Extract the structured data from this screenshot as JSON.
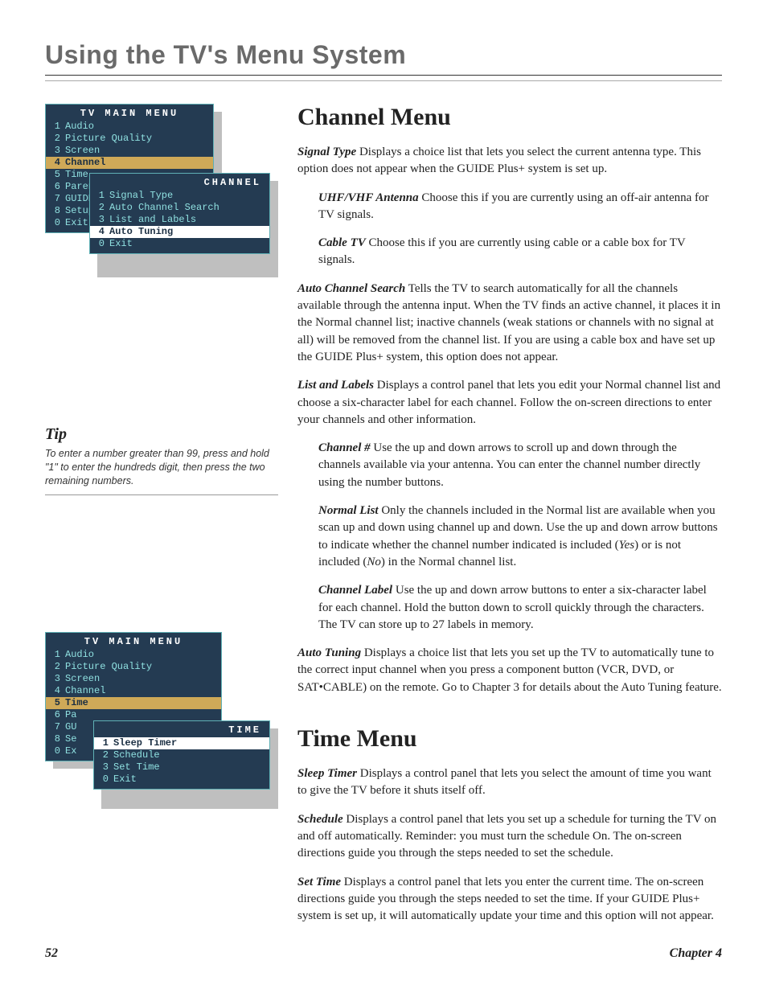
{
  "chapter_title": "Using the TV's Menu System",
  "menu1": {
    "title": "TV MAIN MENU",
    "items": [
      {
        "n": "1",
        "label": "Audio"
      },
      {
        "n": "2",
        "label": "Picture Quality"
      },
      {
        "n": "3",
        "label": "Screen"
      },
      {
        "n": "4",
        "label": "Channel"
      },
      {
        "n": "5",
        "label": "Time"
      },
      {
        "n": "6",
        "label": "Parental"
      },
      {
        "n": "7",
        "label": "GUIDE"
      },
      {
        "n": "8",
        "label": "Setup"
      },
      {
        "n": "0",
        "label": "Exit"
      }
    ],
    "highlight_index": 3,
    "sub_title": "CHANNEL",
    "sub_items": [
      {
        "n": "1",
        "label": "Signal Type"
      },
      {
        "n": "2",
        "label": "Auto Channel Search"
      },
      {
        "n": "3",
        "label": "List and Labels"
      },
      {
        "n": "4",
        "label": "Auto Tuning"
      },
      {
        "n": "0",
        "label": "Exit"
      }
    ],
    "sub_highlight_index": 3
  },
  "menu2": {
    "title": "TV MAIN MENU",
    "items": [
      {
        "n": "1",
        "label": "Audio"
      },
      {
        "n": "2",
        "label": "Picture Quality"
      },
      {
        "n": "3",
        "label": "Screen"
      },
      {
        "n": "4",
        "label": "Channel"
      },
      {
        "n": "5",
        "label": "Time"
      },
      {
        "n": "6",
        "label": "Pa"
      },
      {
        "n": "7",
        "label": "GU"
      },
      {
        "n": "8",
        "label": "Se"
      },
      {
        "n": "0",
        "label": "Ex"
      }
    ],
    "highlight_index": 4,
    "sub_title": "TIME",
    "sub_items": [
      {
        "n": "1",
        "label": "Sleep Timer"
      },
      {
        "n": "2",
        "label": "Schedule"
      },
      {
        "n": "3",
        "label": "Set Time"
      },
      {
        "n": "0",
        "label": "Exit"
      }
    ],
    "sub_highlight_index": 0
  },
  "tip": {
    "heading": "Tip",
    "body": "To enter a number greater than 99, press and hold \"1\" to enter the hundreds digit, then press the two remaining numbers."
  },
  "sections": {
    "channel": {
      "heading": "Channel Menu",
      "p1_term": "Signal Type",
      "p1_text": "   Displays a choice list that lets you select the current antenna type. This option does not appear when the GUIDE Plus+ system is set up.",
      "p1a_term": "UHF/VHF Antenna",
      "p1a_text": "   Choose this if you are currently using an off-air antenna for TV signals.",
      "p1b_term": "Cable TV",
      "p1b_text": "   Choose this if you are currently using cable or a cable box for TV signals.",
      "p2_term": "Auto Channel Search",
      "p2_text": "   Tells the TV to search automatically for all the channels available through the antenna input. When the TV finds an active channel, it places it in the Normal channel list; inactive channels (weak stations or channels with no signal at all) will be removed from the channel list. If you are using a cable box and have set up the GUIDE Plus+ system, this option does not appear.",
      "p3_term": "List and Labels",
      "p3_text": "   Displays a control panel that lets you edit your Normal channel list and choose a six-character label for each channel. Follow the on-screen directions to enter your channels and other information.",
      "p3a_term": "Channel #",
      "p3a_text": "   Use the up and down arrows to scroll up and down through the channels available via your antenna. You can enter the channel number directly using the number buttons.",
      "p3b_term": "Normal List",
      "p3b_pre": "   Only the channels included in the Normal list are available when you scan up and down using channel up and down. Use the up and down arrow buttons to indicate whether the channel number indicated is included (",
      "p3b_yes": "Yes",
      "p3b_mid": ") or is not included (",
      "p3b_no": "No",
      "p3b_post": ") in the Normal channel list.",
      "p3c_term": "Channel Label",
      "p3c_text": "   Use the up and down arrow buttons to enter a six-character label for each channel. Hold the button down to scroll quickly through the characters. The TV can store up to 27 labels in memory.",
      "p4_term": "Auto Tuning",
      "p4_text": "   Displays a choice list that lets you set up the TV to automatically tune to the correct input channel when you press a component button (VCR, DVD, or SAT•CABLE) on the remote. Go to Chapter 3 for details about the Auto Tuning feature."
    },
    "time": {
      "heading": "Time Menu",
      "p1_term": "Sleep Timer",
      "p1_text": "   Displays a control panel that lets you select the amount of time you want to give the TV before it shuts itself off.",
      "p2_term": "Schedule",
      "p2_text": "   Displays a control panel that lets you set up a schedule for turning the TV on and off automatically. Reminder: you must turn the schedule On. The on-screen directions guide you through the steps needed to set the schedule.",
      "p3_term": "Set Time",
      "p3_text": "   Displays a control panel that lets you enter the current time. The on-screen directions guide you through the steps needed to set the time. If your GUIDE Plus+ system is set up, it will automatically update your time and this option will not appear."
    }
  },
  "footer": {
    "page": "52",
    "chapter": "Chapter 4"
  }
}
